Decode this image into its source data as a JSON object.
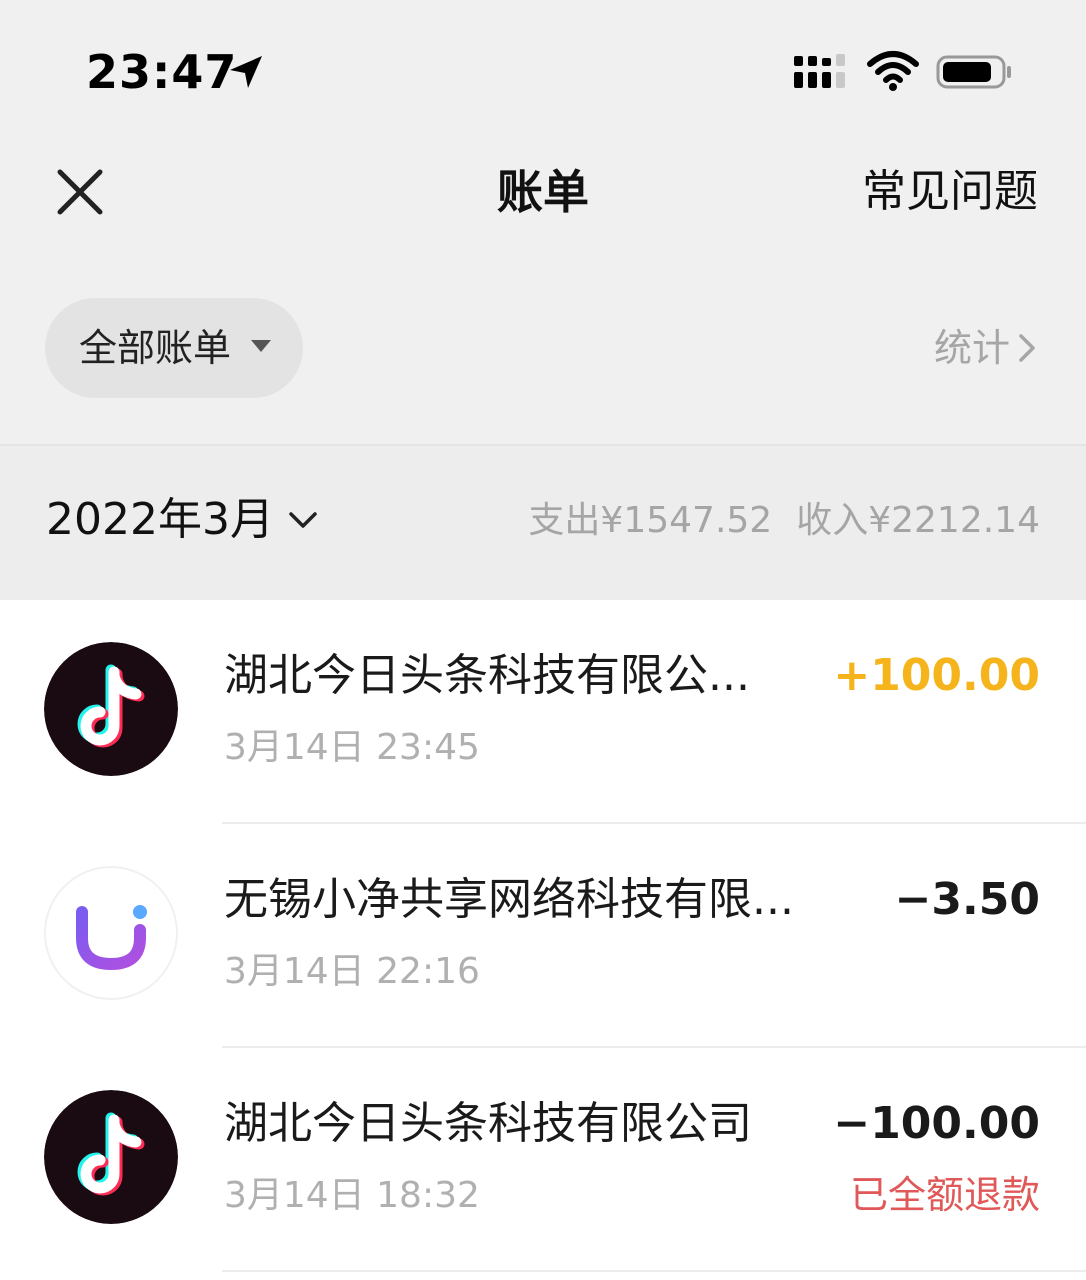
{
  "status_bar": {
    "time": "23:47",
    "location_icon": "location-arrow-icon",
    "signal_icon": "cellular-signal-icon",
    "wifi_icon": "wifi-icon",
    "battery_icon": "battery-icon"
  },
  "nav": {
    "close_icon": "close-icon",
    "title": "账单",
    "faq_label": "常见问题"
  },
  "filter": {
    "label": "全部账单",
    "caret_icon": "caret-down-icon"
  },
  "stats": {
    "label": "统计",
    "chevron_icon": "chevron-right-icon"
  },
  "month": {
    "label": "2022年3月",
    "chevron_icon": "chevron-down-icon",
    "expense_label": "支出",
    "expense_value": "¥1547.52",
    "income_label": "收入",
    "income_value": "¥2212.14"
  },
  "bills": [
    {
      "merchant": "湖北今日头条科技有限公...",
      "time": "3月14日 23:45",
      "amount": "+100.00",
      "type": "income",
      "icon": "tiktok-logo-icon",
      "status": ""
    },
    {
      "merchant": "无锡小净共享网络科技有限...",
      "time": "3月14日 22:16",
      "amount": "−3.50",
      "type": "expense",
      "icon": "u-logo-icon",
      "status": ""
    },
    {
      "merchant": "湖北今日头条科技有限公司",
      "time": "3月14日 18:32",
      "amount": "−100.00",
      "type": "expense",
      "icon": "tiktok-logo-icon",
      "status": "已全额退款"
    }
  ],
  "colors": {
    "income_amount": "#f5b41b",
    "refund_status": "#e05858",
    "header_bg": "#f0f0f0",
    "month_bar_bg": "#ededed"
  }
}
